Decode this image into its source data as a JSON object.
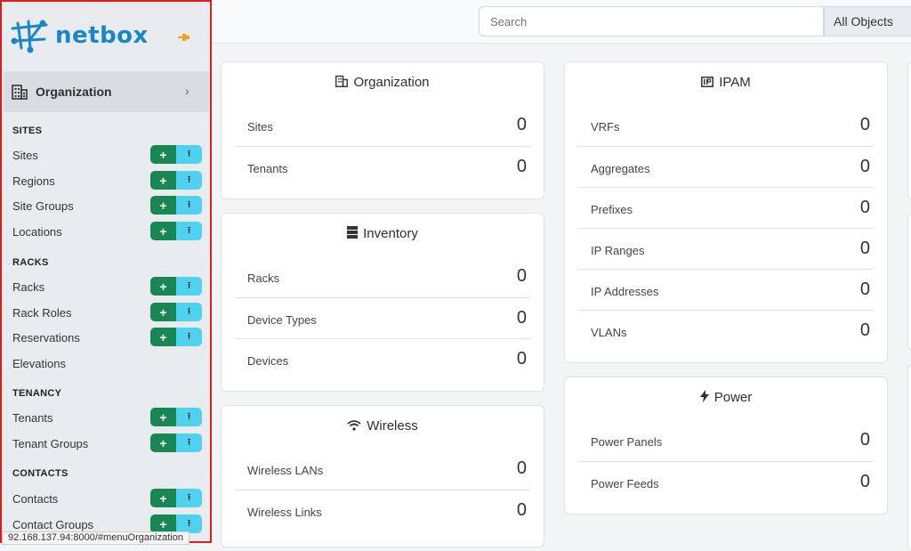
{
  "brand": {
    "name": "netbox"
  },
  "sidebar": {
    "menu_title": "Organization",
    "sections": {
      "sites": "SITES",
      "racks": "RACKS",
      "tenancy": "TENANCY",
      "contacts": "CONTACTS"
    },
    "items": {
      "sites": "Sites",
      "regions": "Regions",
      "site_groups": "Site Groups",
      "locations": "Locations",
      "racks": "Racks",
      "rack_roles": "Rack Roles",
      "reservations": "Reservations",
      "elevations": "Elevations",
      "tenants": "Tenants",
      "tenant_groups": "Tenant Groups",
      "contacts": "Contacts",
      "contact_groups": "Contact Groups"
    },
    "add_symbol": "+",
    "import_symbol": "⭱"
  },
  "search": {
    "placeholder": "Search",
    "scope": "All Objects"
  },
  "status_url": "92.168.137.94:8000/#menuOrganization",
  "cards": {
    "organization": {
      "title": "Organization",
      "rows": [
        {
          "label": "Sites",
          "count": "0"
        },
        {
          "label": "Tenants",
          "count": "0"
        }
      ]
    },
    "inventory": {
      "title": "Inventory",
      "rows": [
        {
          "label": "Racks",
          "count": "0"
        },
        {
          "label": "Device Types",
          "count": "0"
        },
        {
          "label": "Devices",
          "count": "0"
        }
      ]
    },
    "wireless": {
      "title": "Wireless",
      "rows": [
        {
          "label": "Wireless LANs",
          "count": "0"
        },
        {
          "label": "Wireless Links",
          "count": "0"
        }
      ]
    },
    "ipam": {
      "title": "IPAM",
      "rows": [
        {
          "label": "VRFs",
          "count": "0"
        },
        {
          "label": "Aggregates",
          "count": "0"
        },
        {
          "label": "Prefixes",
          "count": "0"
        },
        {
          "label": "IP Ranges",
          "count": "0"
        },
        {
          "label": "IP Addresses",
          "count": "0"
        },
        {
          "label": "VLANs",
          "count": "0"
        }
      ]
    },
    "power": {
      "title": "Power",
      "rows": [
        {
          "label": "Power Panels",
          "count": "0"
        },
        {
          "label": "Power Feeds",
          "count": "0"
        }
      ]
    }
  },
  "colors": {
    "brand": "#1b86c7",
    "add": "#198754",
    "import": "#4fd2f0",
    "highlight": "#e11b22"
  }
}
